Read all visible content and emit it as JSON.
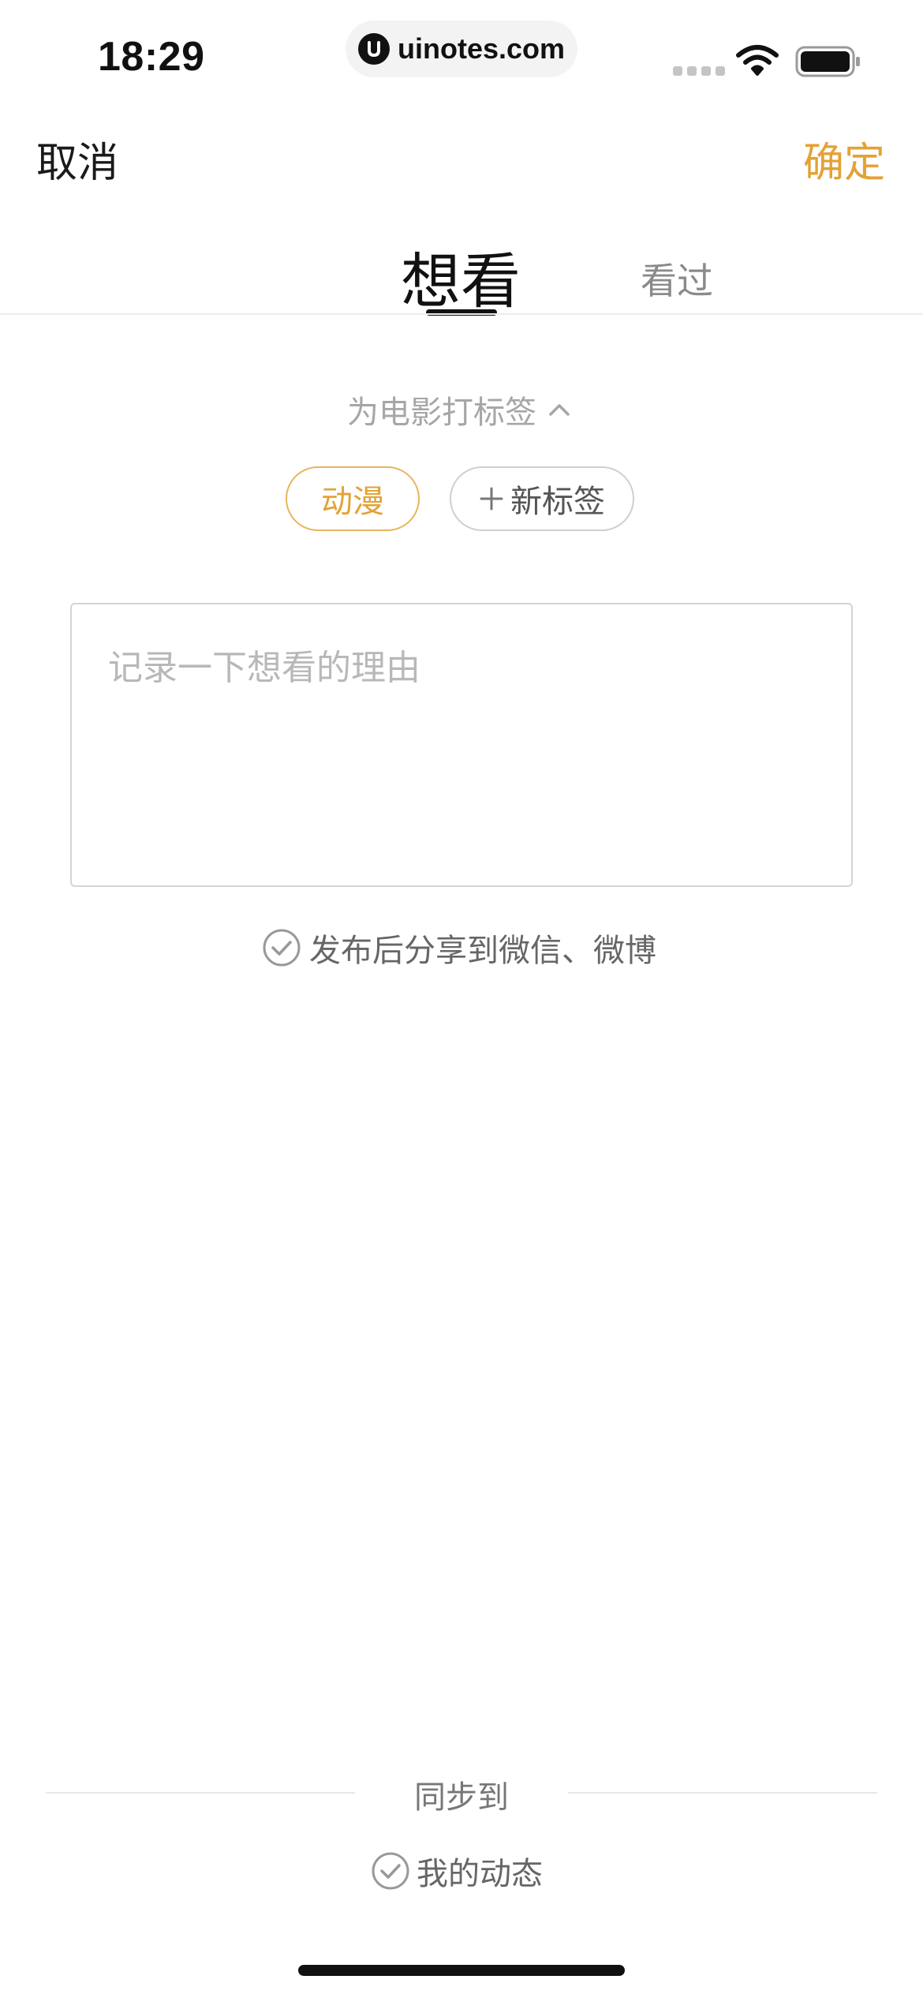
{
  "status_bar": {
    "time": "18:29",
    "url": "uinotes.com",
    "icons": [
      "signal-icon",
      "wifi-icon",
      "battery-icon"
    ]
  },
  "nav": {
    "cancel_label": "取消",
    "confirm_label": "确定"
  },
  "tabs": [
    {
      "label": "想看",
      "active": true
    },
    {
      "label": "看过",
      "active": false
    }
  ],
  "tags": {
    "heading": "为电影打标签",
    "heading_icon": "chevron-up-icon",
    "items": [
      {
        "label": "动漫",
        "selected": true
      }
    ],
    "new_tag_label": "新标签"
  },
  "reason": {
    "placeholder": "记录一下想看的理由",
    "value": ""
  },
  "share": {
    "label": "发布后分享到微信、微博",
    "checked": false
  },
  "sync": {
    "title": "同步到",
    "option_label": "我的动态",
    "checked": false
  },
  "colors": {
    "accent": "#e3a236",
    "chip_border": "#e8b45e",
    "text_primary": "#1a1a1a",
    "text_muted": "#a6a6a6"
  }
}
